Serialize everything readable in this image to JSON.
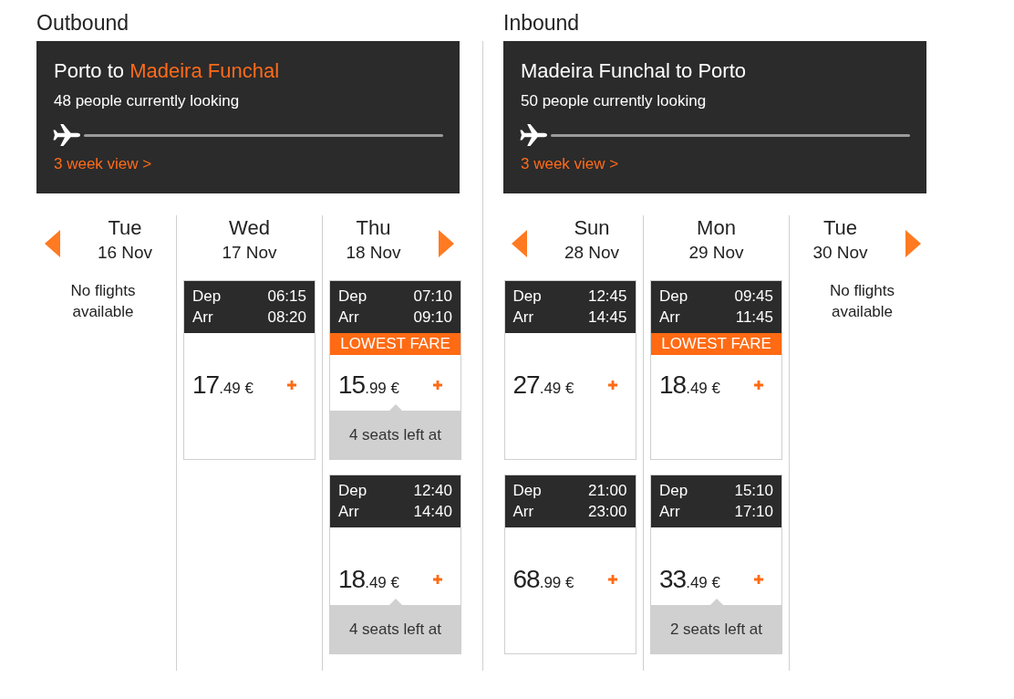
{
  "sections": [
    {
      "heading": "Outbound",
      "title_parts": [
        {
          "text": "Porto to",
          "highlight": false
        },
        {
          "text": "Madeira Funchal",
          "highlight": true
        }
      ],
      "watchers": "48 people currently looking",
      "link": "3 week view >",
      "days": [
        {
          "day": "Tue",
          "date": "16 Nov",
          "message": "No flights available"
        },
        {
          "day": "Wed",
          "date": "17 Nov",
          "flights": [
            {
              "dep_label": "Dep",
              "dep_time": "06:15",
              "arr_label": "Arr",
              "arr_time": "08:20",
              "price_whole": "17",
              "price_rest": ".49 €"
            }
          ]
        },
        {
          "day": "Thu",
          "date": "18 Nov",
          "flights": [
            {
              "dep_label": "Dep",
              "dep_time": "07:10",
              "arr_label": "Arr",
              "arr_time": "09:10",
              "badge": "LOWEST FARE",
              "price_whole": "15",
              "price_rest": ".99 €",
              "seats_left": "4 seats left at"
            },
            {
              "dep_label": "Dep",
              "dep_time": "12:40",
              "arr_label": "Arr",
              "arr_time": "14:40",
              "price_whole": "18",
              "price_rest": ".49 €",
              "seats_left": "4 seats left at"
            }
          ]
        }
      ]
    },
    {
      "heading": "Inbound",
      "title_parts": [
        {
          "text": "Madeira Funchal to Porto",
          "highlight": false
        }
      ],
      "watchers": "50 people currently looking",
      "link": "3 week view >",
      "days": [
        {
          "day": "Sun",
          "date": "28 Nov",
          "flights": [
            {
              "dep_label": "Dep",
              "dep_time": "12:45",
              "arr_label": "Arr",
              "arr_time": "14:45",
              "price_whole": "27",
              "price_rest": ".49 €"
            },
            {
              "dep_label": "Dep",
              "dep_time": "21:00",
              "arr_label": "Arr",
              "arr_time": "23:00",
              "price_whole": "68",
              "price_rest": ".99 €"
            }
          ]
        },
        {
          "day": "Mon",
          "date": "29 Nov",
          "flights": [
            {
              "dep_label": "Dep",
              "dep_time": "09:45",
              "arr_label": "Arr",
              "arr_time": "11:45",
              "badge": "LOWEST FARE",
              "price_whole": "18",
              "price_rest": ".49 €"
            },
            {
              "dep_label": "Dep",
              "dep_time": "15:10",
              "arr_label": "Arr",
              "arr_time": "17:10",
              "price_whole": "33",
              "price_rest": ".49 €",
              "seats_left": "2 seats left at"
            }
          ]
        },
        {
          "day": "Tue",
          "date": "30 Nov",
          "message": "No flights available"
        }
      ]
    }
  ]
}
